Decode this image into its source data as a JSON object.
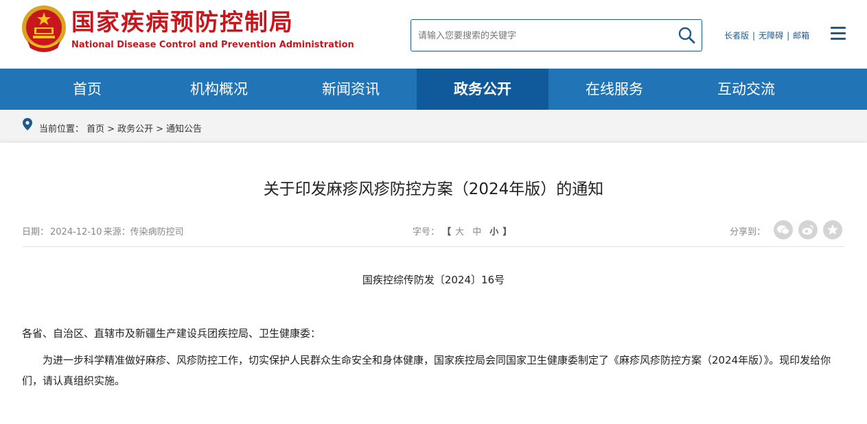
{
  "header": {
    "title_cn": "国家疾病预防控制局",
    "title_en": "National Disease Control and Prevention Administration",
    "logo_icon": "national-emblem-icon",
    "search": {
      "placeholder": "请输入您要搜索的关键字",
      "value": "",
      "icon": "search-icon"
    },
    "links": [
      "长者版",
      "无障碍",
      "邮箱"
    ],
    "menu_icon": "hamburger-menu-icon"
  },
  "nav": {
    "items": [
      "首页",
      "机构概况",
      "新闻资讯",
      "政务公开",
      "在线服务",
      "互动交流"
    ],
    "active": "政务公开"
  },
  "breadcrumb": {
    "prefix": "当前位置：",
    "items": [
      "首页",
      "政务公开",
      "通知公告"
    ],
    "separator": ">"
  },
  "article": {
    "title": "关于印发麻疹风疹防控方案（2024年版）的通知",
    "date_label": "日期：",
    "date": "2024-12-10",
    "source_label": "来源：",
    "source": "传染病防控司",
    "font_size_label": "字号：",
    "font_size_open": "【",
    "font_size_close": "】",
    "font_size_options": [
      "大",
      "中",
      "小"
    ],
    "font_size_selected": "小",
    "share_label": "分享到：",
    "share_icons": [
      "wechat-icon",
      "weibo-icon",
      "favorite-star-icon"
    ],
    "doc_number": "国疾控综传防发〔2024〕16号",
    "salutation": "各省、自治区、直辖市及新疆生产建设兵团疾控局、卫生健康委：",
    "body": "为进一步科学精准做好麻疹、风疹防控工作，切实保护人民群众生命安全和身体健康，国家疾控局会同国家卫生健康委制定了《麻疹风疹防控方案（2024年版）》。现印发给你们，请认真组织实施。"
  },
  "colors": {
    "brand_red": "#c8161d",
    "nav_blue": "#2175b7",
    "nav_active": "#10599a",
    "link_blue": "#1f5a8e"
  }
}
